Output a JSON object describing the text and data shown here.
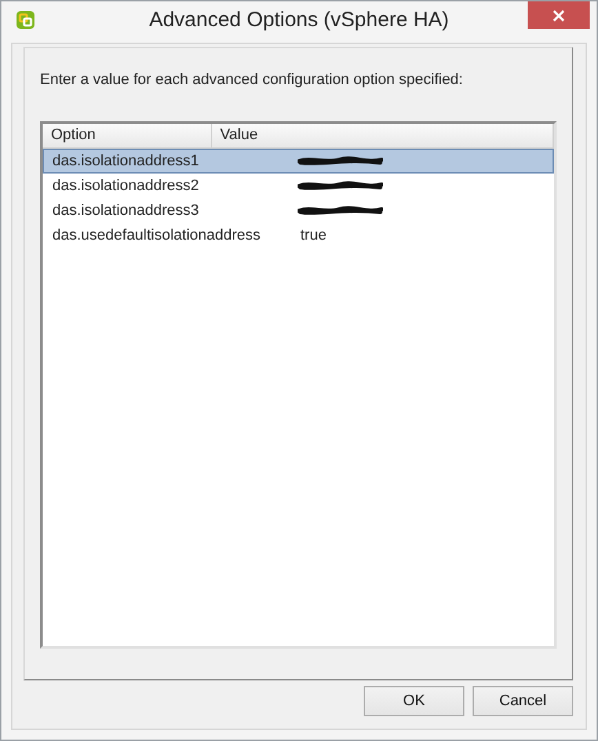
{
  "window": {
    "title": "Advanced Options (vSphere HA)"
  },
  "instruction": "Enter a value for each advanced configuration option specified:",
  "table": {
    "columns": [
      "Option",
      "Value"
    ],
    "rows": [
      {
        "option": "das.isolationaddress1",
        "redacted": true,
        "selected": true
      },
      {
        "option": "das.isolationaddress2",
        "redacted": true,
        "selected": false
      },
      {
        "option": "das.isolationaddress3",
        "redacted": true,
        "selected": false
      },
      {
        "option": "das.usedefaultisolationaddress",
        "value": "true",
        "redacted": false,
        "selected": false
      }
    ]
  },
  "buttons": [
    "OK",
    "Cancel"
  ]
}
